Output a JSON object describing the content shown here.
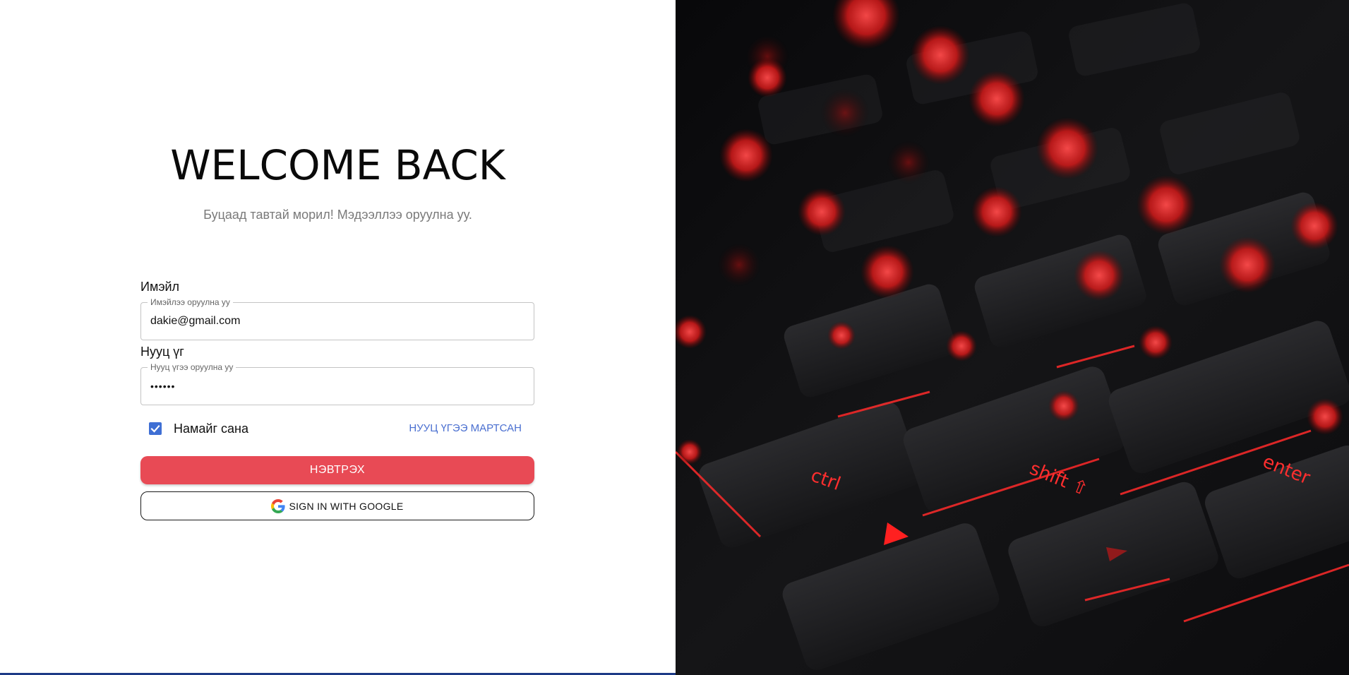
{
  "login": {
    "title": "WELCOME BACK",
    "subtitle": "Буцаад тавтай морил! Мэдээллээ оруулна уу.",
    "email": {
      "label": "Имэйл",
      "legend": "Имэйлээ оруулна уу",
      "value": "dakie@gmail.com"
    },
    "password": {
      "label": "Нууц үг",
      "legend": "Нууц үгээ оруулна уу",
      "value": "••••••"
    },
    "remember": {
      "label": "Намайг сана",
      "checked": true
    },
    "forgot_label": "НУУЦ ҮГЭЭ МАРТСАН",
    "submit_label": "НЭВТРЭХ",
    "google_label": "SIGN IN WITH GOOGLE"
  },
  "hero": {
    "icon": "keyboard-red-backlight-image",
    "key_labels": [
      "ctrl",
      "shift ⇧",
      "enter"
    ]
  },
  "colors": {
    "accent": "#e84a55",
    "link": "#4a6fd0",
    "checkbox": "#3f6fd4"
  }
}
